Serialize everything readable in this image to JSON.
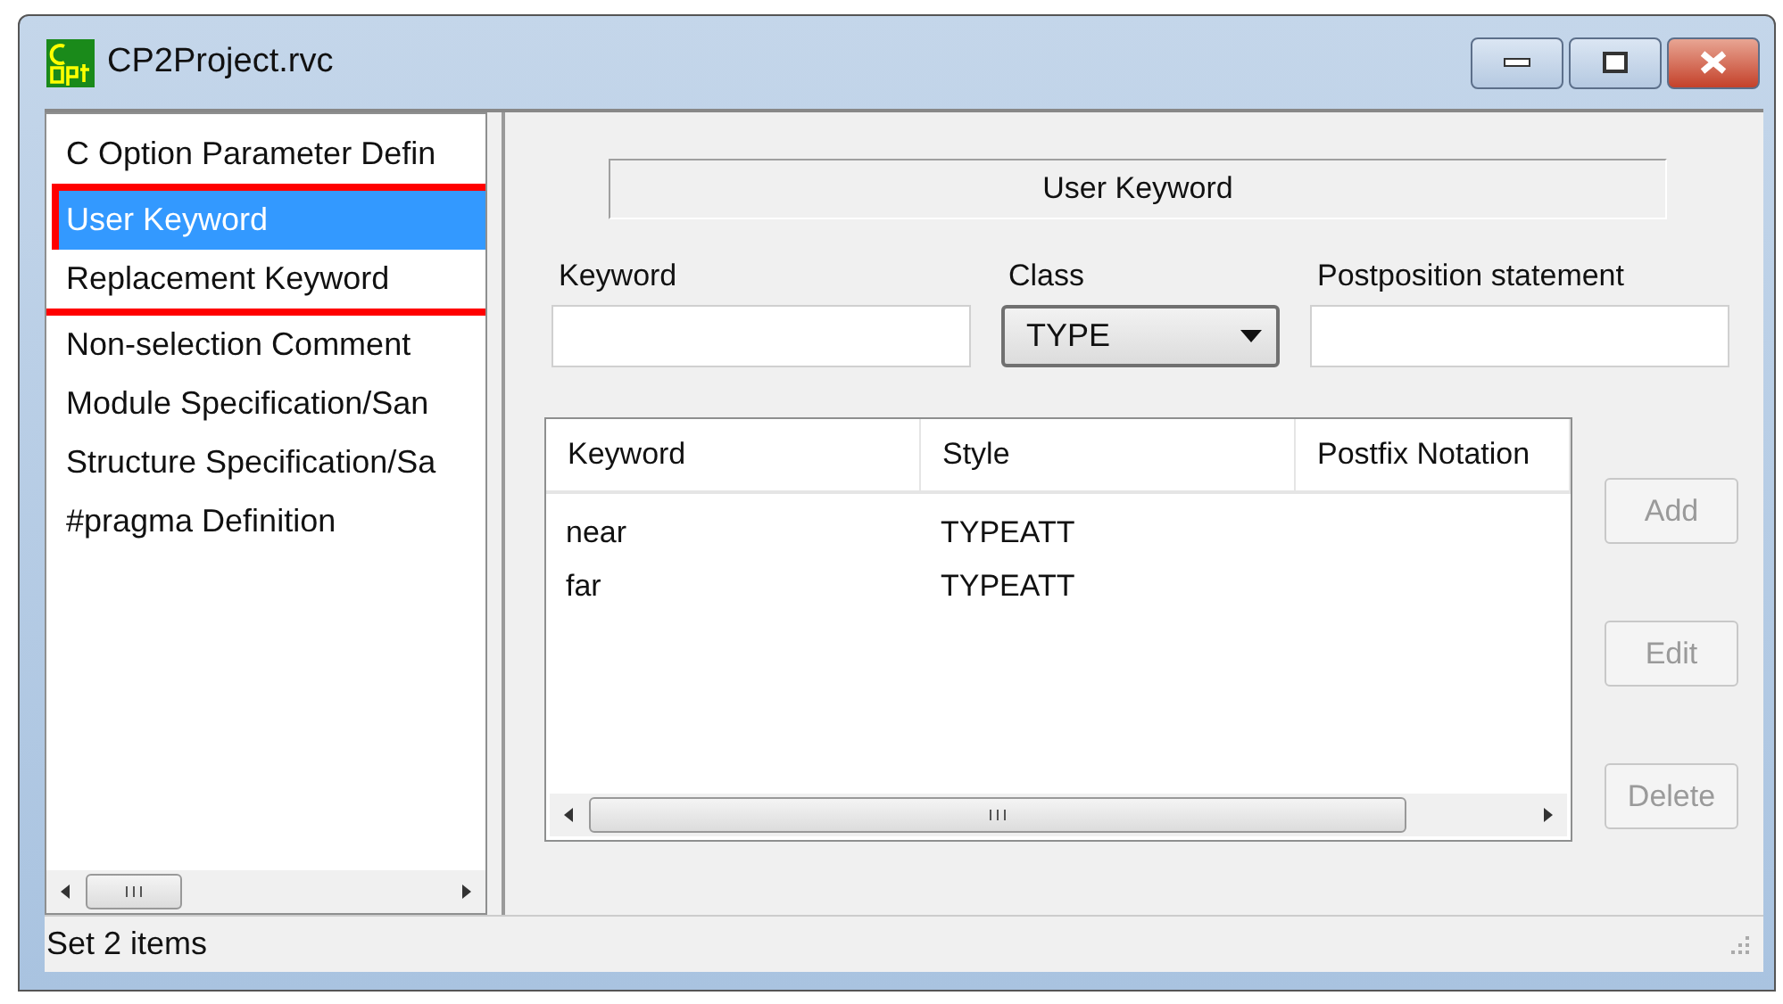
{
  "window": {
    "title": "CP2Project.rvc"
  },
  "sidebar": {
    "items": [
      {
        "label": "C Option Parameter Defin",
        "selected": false,
        "highlighted": false
      },
      {
        "label": "User Keyword",
        "selected": true,
        "highlighted": true
      },
      {
        "label": "Replacement Keyword",
        "selected": false,
        "highlighted": true
      },
      {
        "label": "Non-selection Comment",
        "selected": false,
        "highlighted": false
      },
      {
        "label": "Module Specification/San",
        "selected": false,
        "highlighted": false
      },
      {
        "label": "Structure Specification/Sa",
        "selected": false,
        "highlighted": false
      },
      {
        "label": "#pragma Definition",
        "selected": false,
        "highlighted": false
      }
    ]
  },
  "panel": {
    "heading": "User Keyword",
    "fields": [
      {
        "kind": "text",
        "label": "Keyword"
      },
      {
        "kind": "combo",
        "label": "Class",
        "value": "TYPE"
      },
      {
        "kind": "text",
        "label": "Postposition statement"
      }
    ],
    "table": {
      "columns": [
        "Keyword",
        "Style",
        "Postfix Notation"
      ],
      "rows": [
        [
          "near",
          "TYPEATT"
        ],
        [
          "far",
          "TYPEATT"
        ]
      ]
    },
    "buttons": [
      {
        "label": "Add",
        "disabled": true
      },
      {
        "label": "Edit",
        "disabled": true
      },
      {
        "label": "Delete",
        "disabled": true
      }
    ]
  },
  "status_bar": "Set 2 items"
}
